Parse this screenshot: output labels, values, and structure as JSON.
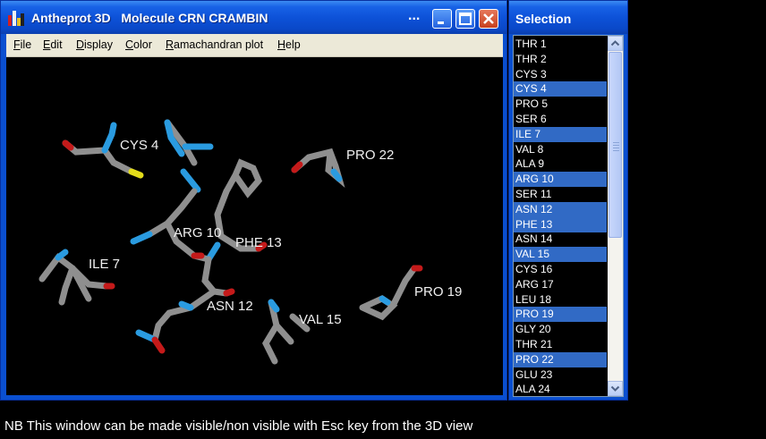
{
  "window": {
    "title": "Antheprot 3D   Molecule CRN CRAMBIN",
    "dots": "...",
    "buttons": [
      "minimize-button",
      "maximize-button",
      "close-button"
    ]
  },
  "menu": [
    {
      "label": "File",
      "key": "F"
    },
    {
      "label": "Edit",
      "key": "E"
    },
    {
      "label": "Display",
      "key": "D"
    },
    {
      "label": "Color",
      "key": "C"
    },
    {
      "label": "Ramachandran plot",
      "key": "R"
    },
    {
      "label": "Help",
      "key": "H"
    }
  ],
  "residue_labels": [
    "CYS 4",
    "PRO 22",
    "ARG 10",
    "PHE 13",
    "ILE 7",
    "PRO 19",
    "ASN 12",
    "VAL 15"
  ],
  "selection": {
    "title": "Selection",
    "items": [
      {
        "label": "THR 1",
        "selected": false
      },
      {
        "label": "THR 2",
        "selected": false
      },
      {
        "label": "CYS 3",
        "selected": false
      },
      {
        "label": "CYS 4",
        "selected": true
      },
      {
        "label": "PRO 5",
        "selected": false
      },
      {
        "label": "SER 6",
        "selected": false
      },
      {
        "label": "ILE 7",
        "selected": true
      },
      {
        "label": "VAL 8",
        "selected": false
      },
      {
        "label": "ALA 9",
        "selected": false
      },
      {
        "label": "ARG 10",
        "selected": true
      },
      {
        "label": "SER 11",
        "selected": false
      },
      {
        "label": "ASN 12",
        "selected": true
      },
      {
        "label": "PHE 13",
        "selected": true
      },
      {
        "label": "ASN 14",
        "selected": false
      },
      {
        "label": "VAL 15",
        "selected": true
      },
      {
        "label": "CYS 16",
        "selected": false
      },
      {
        "label": "ARG 17",
        "selected": false
      },
      {
        "label": "LEU 18",
        "selected": false
      },
      {
        "label": "PRO 19",
        "selected": true
      },
      {
        "label": "GLY 20",
        "selected": false
      },
      {
        "label": "THR 21",
        "selected": false
      },
      {
        "label": "PRO 22",
        "selected": true
      },
      {
        "label": "GLU 23",
        "selected": false
      },
      {
        "label": "ALA 24",
        "selected": false
      }
    ]
  },
  "note": "NB This window can be made visible/non visible with Esc key from the 3D view",
  "colors": {
    "carbon": "#8a8a8a",
    "nitrogen": "#2a9be0",
    "oxygen": "#d01818",
    "sulfur": "#e6e01a",
    "selection_highlight": "#316ac5"
  }
}
